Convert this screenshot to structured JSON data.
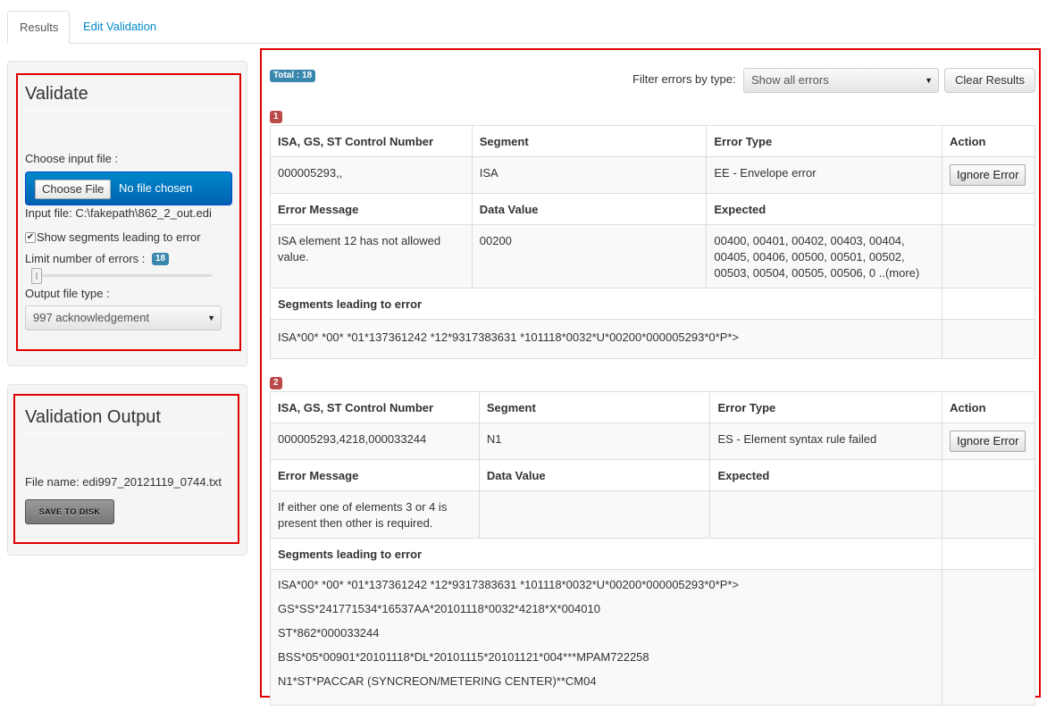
{
  "tabs": [
    {
      "label": "Results",
      "active": true
    },
    {
      "label": "Edit Validation",
      "active": false
    }
  ],
  "validate": {
    "title": "Validate",
    "choose_label": "Choose input file :",
    "choose_button": "Choose File",
    "no_file": "No file chosen",
    "input_file": "Input file: C:\\fakepath\\862_2_out.edi",
    "show_segments_label": "Show segments leading to error",
    "show_segments_checked": true,
    "limit_label": "Limit number of errors :",
    "limit_value": "18",
    "output_type_label": "Output file type :",
    "output_type_value": "997 acknowledgement"
  },
  "output": {
    "title": "Validation Output",
    "file_name": "File name: edi997_20121119_0744.txt",
    "save_button": "SAVE TO DISK"
  },
  "results": {
    "total_label": "Total : 18",
    "filter_label": "Filter errors by type:",
    "filter_value": "Show all errors",
    "clear_button": "Clear Results",
    "headers": {
      "control": "ISA, GS, ST Control Number",
      "segment": "Segment",
      "error_type": "Error Type",
      "action": "Action",
      "error_message": "Error Message",
      "data_value": "Data Value",
      "expected": "Expected",
      "segments_leading": "Segments leading to error"
    },
    "ignore_button": "Ignore Error",
    "errors": [
      {
        "number": "1",
        "control": "000005293,,",
        "segment": "ISA",
        "error_type": "EE - Envelope error",
        "message": "ISA element 12 has not allowed value.",
        "data_value": "00200",
        "expected": "00400, 00401, 00402, 00403, 00404, 00405, 00406, 00500, 00501, 00502, 00503, 00504, 00505, 00506, 0 ..(more)",
        "segments": [
          "ISA*00* *00* *01*137361242 *12*9317383631 *101118*0032*U*00200*000005293*0*P*>"
        ]
      },
      {
        "number": "2",
        "control": "000005293,4218,000033244",
        "segment": "N1",
        "error_type": "ES - Element syntax rule failed",
        "message": "If either one of elements 3 or 4 is present then other is required.",
        "data_value": "",
        "expected": "",
        "segments": [
          "ISA*00* *00* *01*137361242 *12*9317383631 *101118*0032*U*00200*000005293*0*P*>",
          "GS*SS*241771534*16537AA*20101118*0032*4218*X*004010",
          "ST*862*000033244",
          "BSS*05*00901*20101118*DL*20101115*20101121*004***MPAM722258",
          "N1*ST*PACCAR (SYNCREON/METERING CENTER)**CM04"
        ]
      }
    ]
  }
}
